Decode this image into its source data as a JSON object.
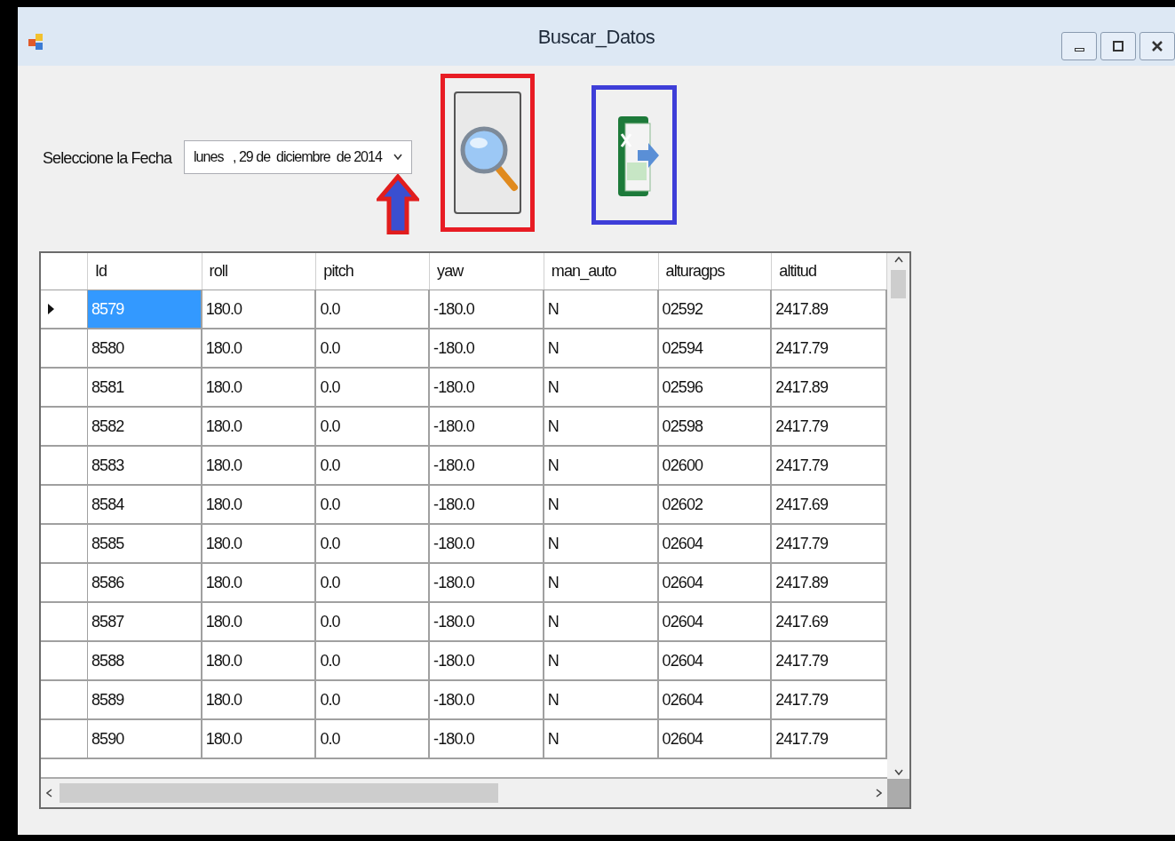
{
  "window": {
    "title": "Buscar_Datos"
  },
  "date_label": "Seleccione la Fecha",
  "date_picker": {
    "value": "lunes   , 29 de  diciembre  de 2014"
  },
  "grid": {
    "columns": [
      "Id",
      "roll",
      "pitch",
      "yaw",
      "man_auto",
      "alturagps",
      "altitud"
    ],
    "rows": [
      {
        "cells": [
          "8579",
          "180.0",
          "0.0",
          "-180.0",
          "N",
          "02592",
          "2417.89"
        ],
        "selected": true
      },
      {
        "cells": [
          "8580",
          "180.0",
          "0.0",
          "-180.0",
          "N",
          "02594",
          "2417.79"
        ],
        "selected": false
      },
      {
        "cells": [
          "8581",
          "180.0",
          "0.0",
          "-180.0",
          "N",
          "02596",
          "2417.89"
        ],
        "selected": false
      },
      {
        "cells": [
          "8582",
          "180.0",
          "0.0",
          "-180.0",
          "N",
          "02598",
          "2417.79"
        ],
        "selected": false
      },
      {
        "cells": [
          "8583",
          "180.0",
          "0.0",
          "-180.0",
          "N",
          "02600",
          "2417.79"
        ],
        "selected": false
      },
      {
        "cells": [
          "8584",
          "180.0",
          "0.0",
          "-180.0",
          "N",
          "02602",
          "2417.69"
        ],
        "selected": false
      },
      {
        "cells": [
          "8585",
          "180.0",
          "0.0",
          "-180.0",
          "N",
          "02604",
          "2417.79"
        ],
        "selected": false
      },
      {
        "cells": [
          "8586",
          "180.0",
          "0.0",
          "-180.0",
          "N",
          "02604",
          "2417.89"
        ],
        "selected": false
      },
      {
        "cells": [
          "8587",
          "180.0",
          "0.0",
          "-180.0",
          "N",
          "02604",
          "2417.69"
        ],
        "selected": false
      },
      {
        "cells": [
          "8588",
          "180.0",
          "0.0",
          "-180.0",
          "N",
          "02604",
          "2417.79"
        ],
        "selected": false
      },
      {
        "cells": [
          "8589",
          "180.0",
          "0.0",
          "-180.0",
          "N",
          "02604",
          "2417.79"
        ],
        "selected": false
      },
      {
        "cells": [
          "8590",
          "180.0",
          "0.0",
          "-180.0",
          "N",
          "02604",
          "2417.79"
        ],
        "selected": false
      }
    ]
  }
}
